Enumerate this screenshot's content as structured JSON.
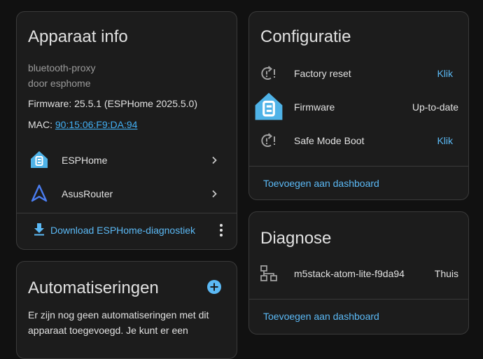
{
  "device_info": {
    "title": "Apparaat info",
    "model": "bluetooth-proxy",
    "manufacturer": "door esphome",
    "firmware": "Firmware: 25.5.1 (ESPHome 2025.5.0)",
    "mac_label": "MAC: ",
    "mac_value": "90:15:06:F9:DA:94",
    "integrations": [
      {
        "label": "ESPHome",
        "icon": "esphome-icon"
      },
      {
        "label": "AsusRouter",
        "icon": "asusrouter-icon"
      }
    ],
    "download_label": "Download ESPHome-diagnostiek"
  },
  "automations": {
    "title": "Automatiseringen",
    "body_line1": "Er zijn nog geen automatiseringen met dit",
    "body_line2": "apparaat toegevoegd. Je kunt er een"
  },
  "configuration": {
    "title": "Configuratie",
    "rows": [
      {
        "label": "Factory reset",
        "value": "Klik",
        "icon": "restart-alert-icon"
      },
      {
        "label": "Firmware",
        "value": "Up-to-date",
        "icon": "esphome-icon"
      },
      {
        "label": "Safe Mode Boot",
        "value": "Klik",
        "icon": "restart-alert-icon"
      }
    ],
    "footer": "Toevoegen aan dashboard"
  },
  "diagnostics": {
    "title": "Diagnose",
    "rows": [
      {
        "label": "m5stack-atom-lite-f9da94",
        "value": "Thuis",
        "icon": "lan-icon"
      }
    ],
    "footer": "Toevoegen aan dashboard"
  },
  "colors": {
    "background": "#111111",
    "card": "#1c1c1c",
    "accent": "#5bb9f5",
    "esphome_blue": "#4fb3e8"
  }
}
